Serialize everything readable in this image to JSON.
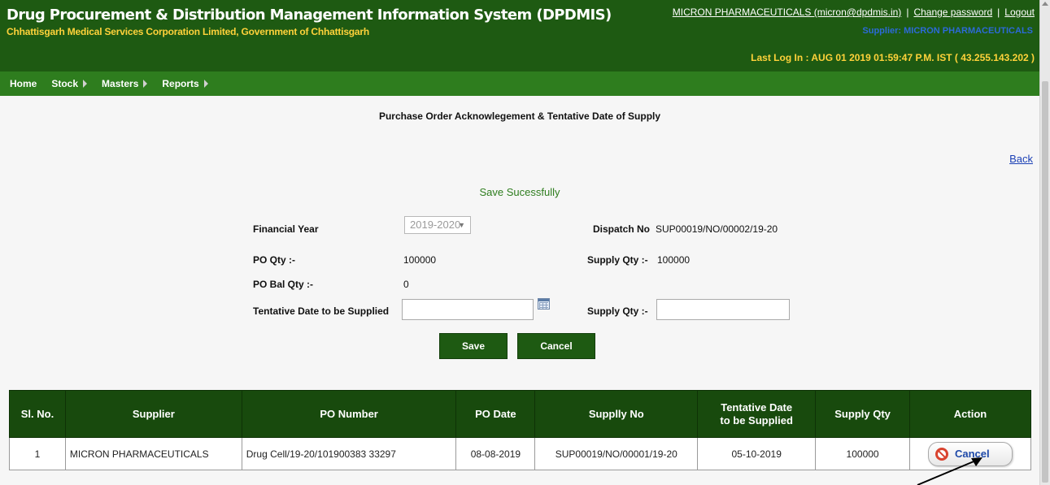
{
  "header": {
    "title": "Drug Procurement & Distribution Management Information System (DPDMIS)",
    "subtitle": "Chhattisgarh Medical Services Corporation Limited, Government of Chhattisgarh",
    "user_link": "MICRON PHARMACEUTICALS (micron@dpdmis.in)",
    "separator": "|",
    "change_password": "Change password",
    "logout": "Logout",
    "supplier_line": "Supplier: MICRON PHARMACEUTICALS",
    "last_login": "Last Log In : AUG 01 2019 01:59:47 P.M. IST ( 43.255.143.202 )"
  },
  "nav": {
    "items": [
      {
        "label": "Home"
      },
      {
        "label": "Stock"
      },
      {
        "label": "Masters"
      },
      {
        "label": "Reports"
      }
    ]
  },
  "page": {
    "title": "Purchase Order Acknowlegement & Tentative Date of Supply",
    "back": "Back",
    "status_message": "Save Sucessfully"
  },
  "form": {
    "financial_year_label": "Financial Year",
    "financial_year_value": "2019-2020",
    "dispatch_no_label": "Dispatch No",
    "dispatch_no_value": "SUP00019/NO/00002/19-20",
    "po_qty_label": "PO Qty :-",
    "po_qty_value": "100000",
    "supply_qty_label": "Supply Qty :-",
    "supply_qty_value": "100000",
    "po_bal_qty_label": "PO Bal Qty :-",
    "po_bal_qty_value": "0",
    "tentative_date_label": "Tentative Date to be Supplied",
    "tentative_date_value": "",
    "supply_qty_input_label": "Supply Qty :-",
    "supply_qty_input_value": "",
    "save_label": "Save",
    "cancel_label": "Cancel"
  },
  "table": {
    "headers": [
      "Sl. No.",
      "Supplier",
      "PO Number",
      "PO Date",
      "Supplly No",
      "Tentative Date to be Supplied",
      "Supply Qty",
      "Action"
    ],
    "rows": [
      {
        "sl": "1",
        "supplier": "MICRON PHARMACEUTICALS",
        "po_number": "Drug Cell/19-20/101900383 33297",
        "po_date": "08-08-2019",
        "supply_no": "SUP00019/NO/00001/19-20",
        "tentative_date": "05-10-2019",
        "supply_qty": "100000",
        "action": "Cancel"
      }
    ]
  },
  "colors": {
    "header_bg": "#1e5a12",
    "nav_bg": "#2e7d1e",
    "accent_yellow": "#ffd23a",
    "table_header_bg": "#184a0d",
    "status_green": "#2e7d1e"
  }
}
